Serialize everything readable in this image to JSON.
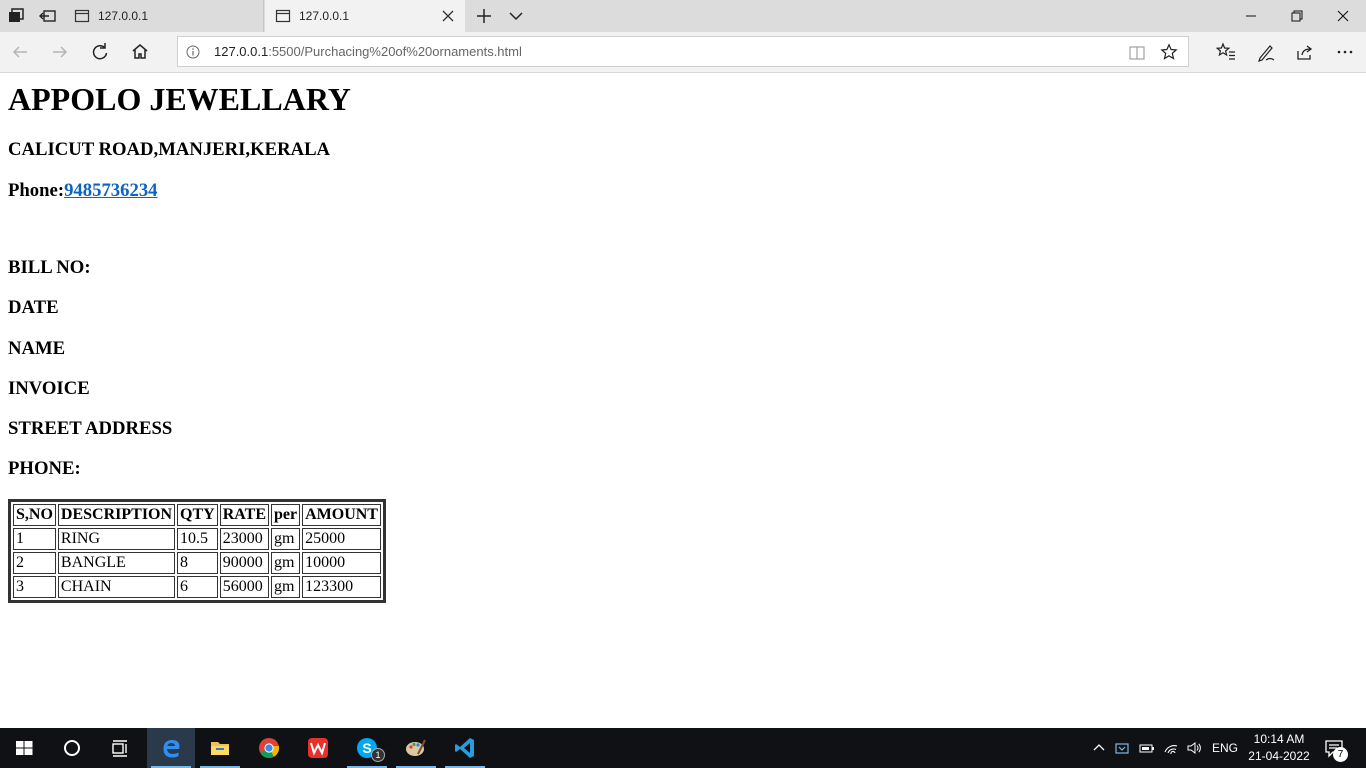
{
  "browser": {
    "tabs": [
      {
        "title": "127.0.0.1",
        "active": false
      },
      {
        "title": "127.0.0.1",
        "active": true
      }
    ],
    "url_host": "127.0.0.1",
    "url_path": ":5500/Purchacing%20of%20ornaments.html"
  },
  "page": {
    "shop_name": "APPOLO JEWELLARY",
    "address": "CALICUT ROAD,MANJERI,KERALA",
    "phone_label": "Phone:",
    "phone_number": "9485736234",
    "fields": {
      "bill_no": "BILL NO:",
      "date": "DATE",
      "name": "NAME",
      "invoice": "INVOICE",
      "street_address": "STREET ADDRESS",
      "phone": "PHONE:"
    },
    "table": {
      "headers": [
        "S,NO",
        "DESCRIPTION",
        "QTY",
        "RATE",
        "per",
        "AMOUNT"
      ],
      "rows": [
        [
          "1",
          "RING",
          "10.5",
          "23000",
          "gm",
          "25000"
        ],
        [
          "2",
          "BANGLE",
          "8",
          "90000",
          "gm",
          "10000"
        ],
        [
          "3",
          "CHAIN",
          "6",
          "56000",
          "gm",
          "123300"
        ]
      ]
    }
  },
  "taskbar": {
    "language": "ENG",
    "time": "10:14 AM",
    "date": "21-04-2022",
    "skype_badge": "1",
    "notification_count": "7"
  }
}
